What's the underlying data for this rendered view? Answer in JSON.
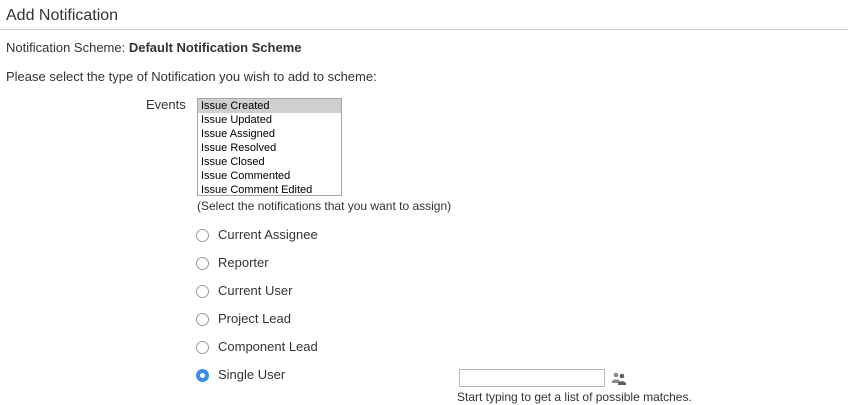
{
  "page": {
    "title": "Add Notification"
  },
  "scheme": {
    "label": "Notification Scheme:",
    "name": "Default Notification Scheme"
  },
  "instruction": "Please select the type of Notification you wish to add to scheme:",
  "events": {
    "label": "Events",
    "options": [
      {
        "label": "Issue Created",
        "selected": true
      },
      {
        "label": "Issue Updated",
        "selected": false
      },
      {
        "label": "Issue Assigned",
        "selected": false
      },
      {
        "label": "Issue Resolved",
        "selected": false
      },
      {
        "label": "Issue Closed",
        "selected": false
      },
      {
        "label": "Issue Commented",
        "selected": false
      },
      {
        "label": "Issue Comment Edited",
        "selected": false
      }
    ],
    "hint": "(Select the notifications that you want to assign)"
  },
  "recipients": [
    {
      "label": "Current Assignee",
      "checked": false
    },
    {
      "label": "Reporter",
      "checked": false
    },
    {
      "label": "Current User",
      "checked": false
    },
    {
      "label": "Project Lead",
      "checked": false
    },
    {
      "label": "Component Lead",
      "checked": false
    },
    {
      "label": "Single User",
      "checked": true
    }
  ],
  "single_user": {
    "value": "",
    "picker_icon": "user-picker-icon",
    "hint": "Start typing to get a list of possible matches."
  },
  "colors": {
    "accent": "#3b8de8",
    "selected_option_bg": "#cfcfcf",
    "divider": "#cccccc"
  }
}
